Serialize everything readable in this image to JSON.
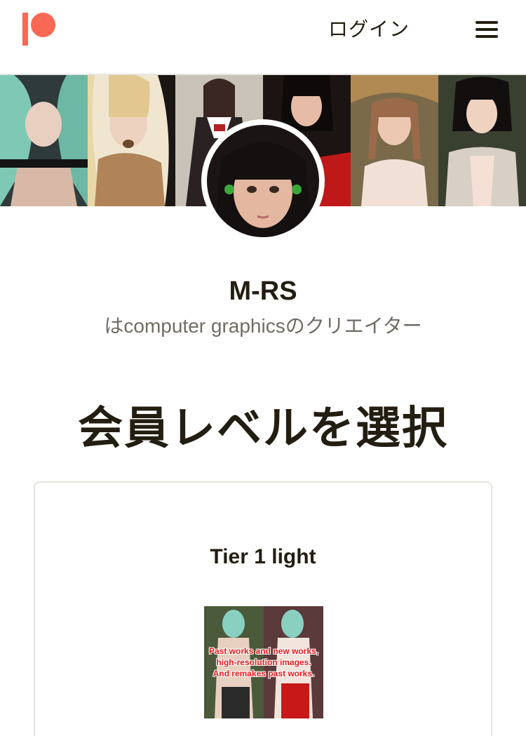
{
  "header": {
    "logo_icon": "patreon-logo-icon",
    "login_label": "ログイン",
    "menu_icon": "hamburger-menu-icon"
  },
  "banner": {
    "tiles": [
      {
        "palette": [
          "#2e3b3a",
          "#7fc9b4",
          "#1a1a1a"
        ]
      },
      {
        "palette": [
          "#e8d8b8",
          "#c49a66",
          "#5a3e22"
        ]
      },
      {
        "palette": [
          "#3a2e2e",
          "#e2c2b0",
          "#b22222"
        ]
      },
      {
        "palette": [
          "#1c1412",
          "#e0b49a",
          "#c01818"
        ]
      },
      {
        "palette": [
          "#c7a070",
          "#e8c7b0",
          "#8a6a40"
        ]
      },
      {
        "palette": [
          "#2c2420",
          "#f0d8c8",
          "#b8a898"
        ]
      }
    ]
  },
  "creator": {
    "name": "M-RS",
    "subtitle": "はcomputer graphicsのクリエイター"
  },
  "section": {
    "title": "会員レベルを選択"
  },
  "tier": {
    "name": "Tier 1 light",
    "image_caption": "Past works and new works,\nhigh-resolution images.\nAnd remakes past works."
  },
  "colors": {
    "brand": "#f96854",
    "text": "#241e12",
    "muted": "#706c64",
    "card_border": "#e5e3dd"
  }
}
